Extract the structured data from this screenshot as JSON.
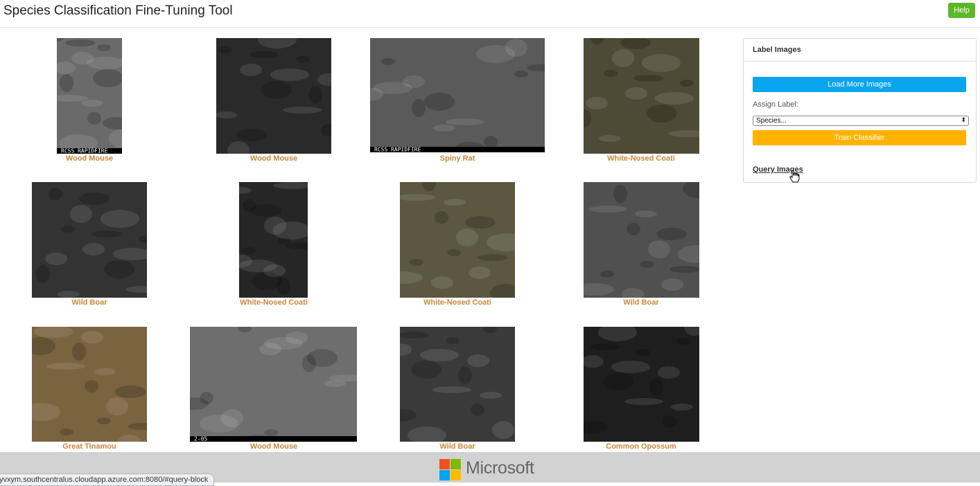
{
  "header": {
    "title": "Species Classification Fine-Tuning Tool",
    "help_label": "Help"
  },
  "images": [
    {
      "label": "Wood Mouse",
      "overlay": "RCSS RAPIDFIRE",
      "tone": "#6a6a6a"
    },
    {
      "label": "Wood Mouse",
      "overlay": "",
      "tone": "#2a2a2a"
    },
    {
      "label": "Spiny Rat",
      "overlay": "RCSS RAPIDFIRE",
      "tone": "#5a5a5a"
    },
    {
      "label": "White-Nosed Coati",
      "overlay": "",
      "tone": "#4d4a36"
    },
    {
      "label": "Wild Boar",
      "overlay": "",
      "tone": "#333333"
    },
    {
      "label": "White-Nosed Coati",
      "overlay": "",
      "tone": "#262626"
    },
    {
      "label": "White-Nosed Coati",
      "overlay": "",
      "tone": "#5b5740"
    },
    {
      "label": "Wild Boar",
      "overlay": "",
      "tone": "#505050"
    },
    {
      "label": "Great Tinamou",
      "overlay": "",
      "tone": "#7a6440"
    },
    {
      "label": "Wood Mouse",
      "overlay": "2-05",
      "tone": "#6e6e6e"
    },
    {
      "label": "Wild Boar",
      "overlay": "",
      "tone": "#3a3a3a"
    },
    {
      "label": "Common Opossum",
      "overlay": "",
      "tone": "#1e1e1e"
    }
  ],
  "panel": {
    "title": "Label Images",
    "load_more_label": "Load More Images",
    "assign_label": "Assign Label:",
    "species_select_value": "Species...",
    "train_label": "Train Classifier",
    "query_label": "Query Images"
  },
  "footer": {
    "brand": "Microsoft",
    "status_url": "yvxym.southcentralus.cloudapp.azure.com:8080/#query-block",
    "logo_colors": [
      "#f25022",
      "#7fba00",
      "#00a4ef",
      "#ffb900"
    ]
  }
}
